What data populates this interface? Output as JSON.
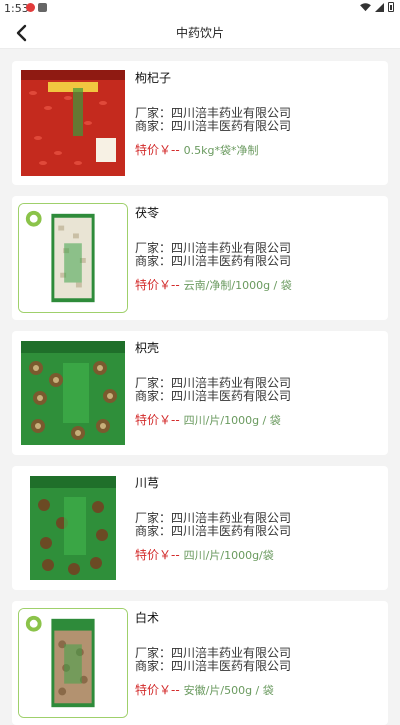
{
  "status_bar": {
    "time": "1:53"
  },
  "header": {
    "title": "中药饮片"
  },
  "colors": {
    "price_red": "#d32b2b",
    "spec_green": "#6a9a5f",
    "frame_green": "#9fd06b"
  },
  "products": [
    {
      "name": "枸杞子",
      "manufacturer": "厂家：四川涪丰药业有限公司",
      "merchant": "商家：四川涪丰医药有限公司",
      "price_label": "特价￥--",
      "spec": "0.5kg*袋*净制"
    },
    {
      "name": "茯苓",
      "manufacturer": "厂家：四川涪丰药业有限公司",
      "merchant": "商家：四川涪丰医药有限公司",
      "price_label": "特价￥--",
      "spec": "云南/净制/1000g / 袋"
    },
    {
      "name": "枳壳",
      "manufacturer": "厂家：四川涪丰药业有限公司",
      "merchant": "商家：四川涪丰医药有限公司",
      "price_label": "特价￥--",
      "spec": "四川/片/1000g / 袋"
    },
    {
      "name": "川芎",
      "manufacturer": "厂家：四川涪丰药业有限公司",
      "merchant": "商家：四川涪丰医药有限公司",
      "price_label": "特价￥--",
      "spec": "四川/片/1000g/袋"
    },
    {
      "name": "白术",
      "manufacturer": "厂家：四川涪丰药业有限公司",
      "merchant": "商家：四川涪丰医药有限公司",
      "price_label": "特价￥--",
      "spec": "安徽/片/500g / 袋"
    }
  ]
}
